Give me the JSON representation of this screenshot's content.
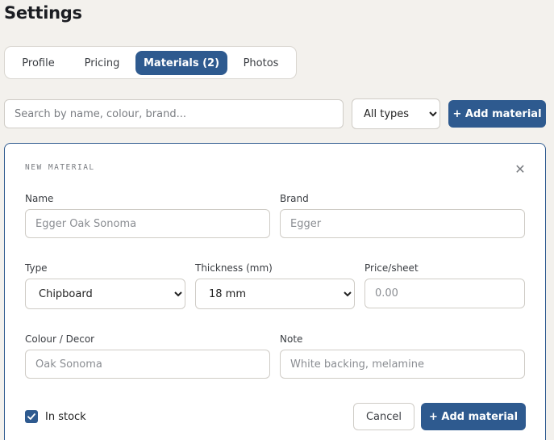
{
  "page": {
    "title": "Settings"
  },
  "tabs": [
    {
      "label": "Profile",
      "active": false
    },
    {
      "label": "Pricing",
      "active": false
    },
    {
      "label": "Materials (2)",
      "active": true
    },
    {
      "label": "Photos",
      "active": false
    }
  ],
  "toolbar": {
    "search_placeholder": "Search by name, colour, brand...",
    "type_filter": {
      "selected": "All types",
      "options": [
        "All types"
      ]
    },
    "add_label": "+ Add material"
  },
  "new_material": {
    "title": "NEW MATERIAL",
    "close_icon": "close-icon",
    "name": {
      "label": "Name",
      "placeholder": "Egger Oak Sonoma",
      "value": ""
    },
    "brand": {
      "label": "Brand",
      "placeholder": "Egger",
      "value": ""
    },
    "type": {
      "label": "Type",
      "selected": "Chipboard",
      "options": [
        "Chipboard"
      ]
    },
    "thickness": {
      "label": "Thickness (mm)",
      "selected": "18 mm",
      "options": [
        "18 mm"
      ]
    },
    "price": {
      "label": "Price/sheet",
      "placeholder": "0.00",
      "value": ""
    },
    "colour": {
      "label": "Colour / Decor",
      "placeholder": "Oak Sonoma",
      "value": ""
    },
    "note": {
      "label": "Note",
      "placeholder": "White backing, melamine",
      "value": ""
    },
    "in_stock": {
      "label": "In stock",
      "checked": true
    },
    "cancel_label": "Cancel",
    "submit_label": "+ Add material"
  },
  "colors": {
    "accent": "#2e5a8f",
    "background": "#f3f1ed"
  }
}
